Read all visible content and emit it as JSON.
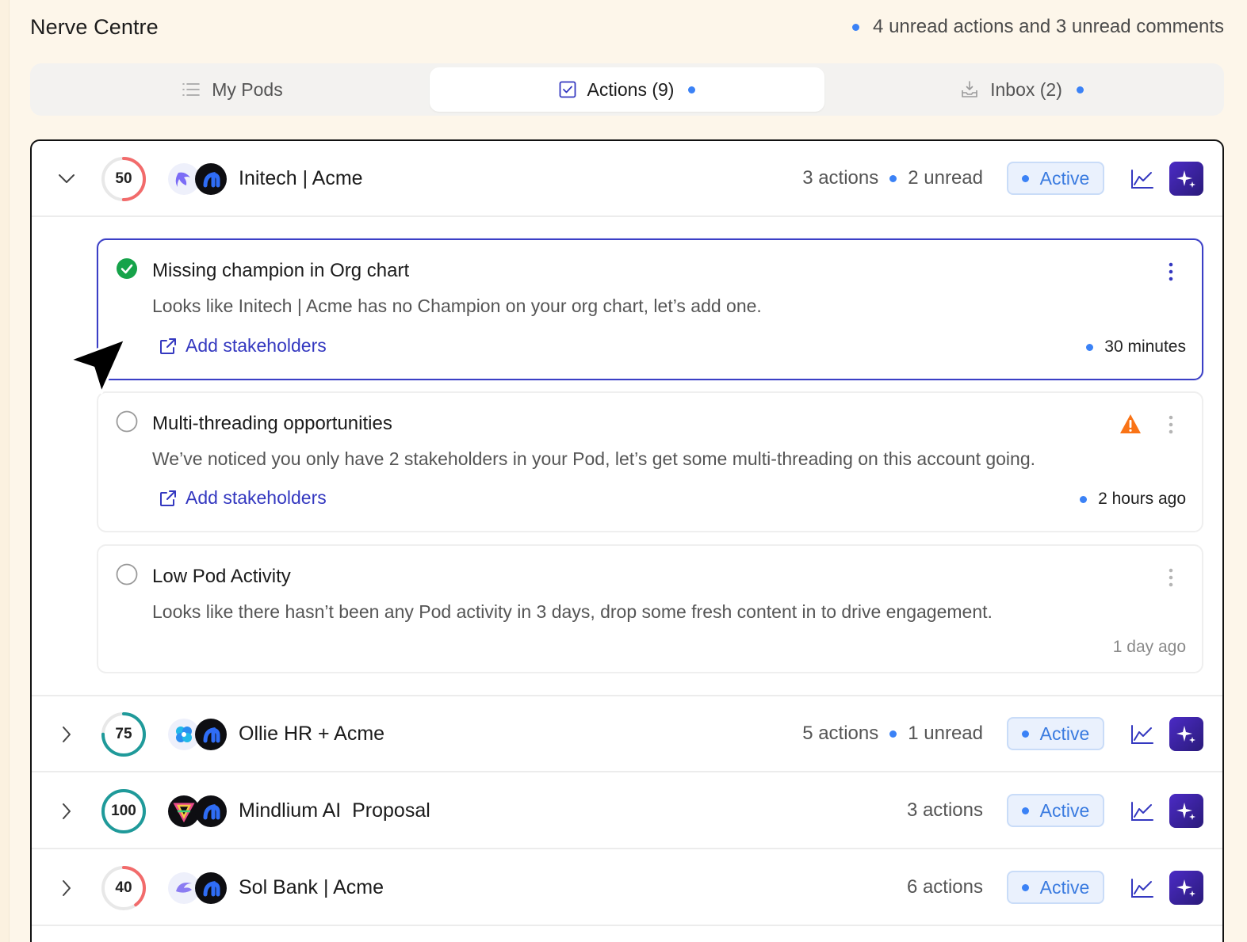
{
  "header": {
    "title": "Nerve Centre",
    "unread_summary": "4 unread actions and 3 unread comments"
  },
  "tabs": [
    {
      "label": "My Pods",
      "icon": "list-icon"
    },
    {
      "label": "Actions (9)",
      "icon": "checkbox-icon"
    },
    {
      "label": "Inbox (2)",
      "icon": "inbox-icon"
    }
  ],
  "pods": [
    {
      "score": "50",
      "name": "Initech | Acme",
      "actions": "3 actions",
      "unread": "2 unread",
      "status": "Active",
      "expanded": true,
      "score_color": "#f26b6b",
      "score_fraction": 0.5
    },
    {
      "score": "75",
      "name": "Ollie HR + Acme",
      "actions": "5 actions",
      "unread": "1 unread",
      "status": "Active",
      "expanded": false,
      "score_color": "#1f9a9a",
      "score_fraction": 0.75
    },
    {
      "score": "100",
      "name": "Mindlium AI  Proposal",
      "actions": "3 actions",
      "status": "Active",
      "expanded": false,
      "score_color": "#1f9a9a",
      "score_fraction": 1.0
    },
    {
      "score": "40",
      "name": "Sol Bank | Acme",
      "actions": "6 actions",
      "status": "Active",
      "expanded": false,
      "score_color": "#f26b6b",
      "score_fraction": 0.4
    }
  ],
  "actions": [
    {
      "title": "Missing champion in Org chart",
      "description": "Looks like Initech | Acme has no Champion on your org chart, let’s add one.",
      "link": "Add stakeholders",
      "time": "30 minutes",
      "completed": true,
      "warning": false
    },
    {
      "title": "Multi-threading opportunities",
      "description": "We’ve noticed you only have 2 stakeholders in your Pod, let’s get some multi-threading on this account going.",
      "link": "Add stakeholders",
      "time": "2 hours ago",
      "completed": false,
      "warning": true
    },
    {
      "title": "Low Pod Activity",
      "description": "Looks like there hasn’t been any Pod activity in 3 days, drop some fresh content in to drive engagement.",
      "time": "1 day ago",
      "completed": false,
      "warning": false
    }
  ],
  "colors": {
    "accent": "#3b82f6",
    "link": "#3438c0",
    "check": "#16a34a",
    "warning": "#f97316",
    "ai": "#4b2bc5"
  }
}
